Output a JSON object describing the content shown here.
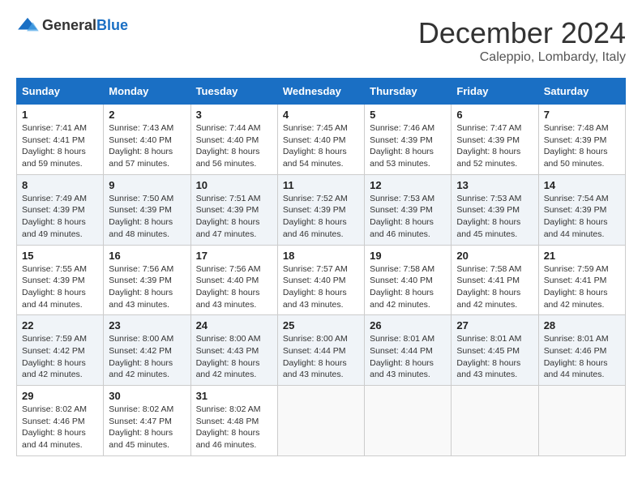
{
  "logo": {
    "general": "General",
    "blue": "Blue"
  },
  "title": "December 2024",
  "subtitle": "Caleppio, Lombardy, Italy",
  "weekdays": [
    "Sunday",
    "Monday",
    "Tuesday",
    "Wednesday",
    "Thursday",
    "Friday",
    "Saturday"
  ],
  "weeks": [
    [
      {
        "day": "1",
        "sunrise": "7:41 AM",
        "sunset": "4:41 PM",
        "daylight": "8 hours and 59 minutes."
      },
      {
        "day": "2",
        "sunrise": "7:43 AM",
        "sunset": "4:40 PM",
        "daylight": "8 hours and 57 minutes."
      },
      {
        "day": "3",
        "sunrise": "7:44 AM",
        "sunset": "4:40 PM",
        "daylight": "8 hours and 56 minutes."
      },
      {
        "day": "4",
        "sunrise": "7:45 AM",
        "sunset": "4:40 PM",
        "daylight": "8 hours and 54 minutes."
      },
      {
        "day": "5",
        "sunrise": "7:46 AM",
        "sunset": "4:39 PM",
        "daylight": "8 hours and 53 minutes."
      },
      {
        "day": "6",
        "sunrise": "7:47 AM",
        "sunset": "4:39 PM",
        "daylight": "8 hours and 52 minutes."
      },
      {
        "day": "7",
        "sunrise": "7:48 AM",
        "sunset": "4:39 PM",
        "daylight": "8 hours and 50 minutes."
      }
    ],
    [
      {
        "day": "8",
        "sunrise": "7:49 AM",
        "sunset": "4:39 PM",
        "daylight": "8 hours and 49 minutes."
      },
      {
        "day": "9",
        "sunrise": "7:50 AM",
        "sunset": "4:39 PM",
        "daylight": "8 hours and 48 minutes."
      },
      {
        "day": "10",
        "sunrise": "7:51 AM",
        "sunset": "4:39 PM",
        "daylight": "8 hours and 47 minutes."
      },
      {
        "day": "11",
        "sunrise": "7:52 AM",
        "sunset": "4:39 PM",
        "daylight": "8 hours and 46 minutes."
      },
      {
        "day": "12",
        "sunrise": "7:53 AM",
        "sunset": "4:39 PM",
        "daylight": "8 hours and 46 minutes."
      },
      {
        "day": "13",
        "sunrise": "7:53 AM",
        "sunset": "4:39 PM",
        "daylight": "8 hours and 45 minutes."
      },
      {
        "day": "14",
        "sunrise": "7:54 AM",
        "sunset": "4:39 PM",
        "daylight": "8 hours and 44 minutes."
      }
    ],
    [
      {
        "day": "15",
        "sunrise": "7:55 AM",
        "sunset": "4:39 PM",
        "daylight": "8 hours and 44 minutes."
      },
      {
        "day": "16",
        "sunrise": "7:56 AM",
        "sunset": "4:39 PM",
        "daylight": "8 hours and 43 minutes."
      },
      {
        "day": "17",
        "sunrise": "7:56 AM",
        "sunset": "4:40 PM",
        "daylight": "8 hours and 43 minutes."
      },
      {
        "day": "18",
        "sunrise": "7:57 AM",
        "sunset": "4:40 PM",
        "daylight": "8 hours and 43 minutes."
      },
      {
        "day": "19",
        "sunrise": "7:58 AM",
        "sunset": "4:40 PM",
        "daylight": "8 hours and 42 minutes."
      },
      {
        "day": "20",
        "sunrise": "7:58 AM",
        "sunset": "4:41 PM",
        "daylight": "8 hours and 42 minutes."
      },
      {
        "day": "21",
        "sunrise": "7:59 AM",
        "sunset": "4:41 PM",
        "daylight": "8 hours and 42 minutes."
      }
    ],
    [
      {
        "day": "22",
        "sunrise": "7:59 AM",
        "sunset": "4:42 PM",
        "daylight": "8 hours and 42 minutes."
      },
      {
        "day": "23",
        "sunrise": "8:00 AM",
        "sunset": "4:42 PM",
        "daylight": "8 hours and 42 minutes."
      },
      {
        "day": "24",
        "sunrise": "8:00 AM",
        "sunset": "4:43 PM",
        "daylight": "8 hours and 42 minutes."
      },
      {
        "day": "25",
        "sunrise": "8:00 AM",
        "sunset": "4:44 PM",
        "daylight": "8 hours and 43 minutes."
      },
      {
        "day": "26",
        "sunrise": "8:01 AM",
        "sunset": "4:44 PM",
        "daylight": "8 hours and 43 minutes."
      },
      {
        "day": "27",
        "sunrise": "8:01 AM",
        "sunset": "4:45 PM",
        "daylight": "8 hours and 43 minutes."
      },
      {
        "day": "28",
        "sunrise": "8:01 AM",
        "sunset": "4:46 PM",
        "daylight": "8 hours and 44 minutes."
      }
    ],
    [
      {
        "day": "29",
        "sunrise": "8:02 AM",
        "sunset": "4:46 PM",
        "daylight": "8 hours and 44 minutes."
      },
      {
        "day": "30",
        "sunrise": "8:02 AM",
        "sunset": "4:47 PM",
        "daylight": "8 hours and 45 minutes."
      },
      {
        "day": "31",
        "sunrise": "8:02 AM",
        "sunset": "4:48 PM",
        "daylight": "8 hours and 46 minutes."
      },
      null,
      null,
      null,
      null
    ]
  ]
}
